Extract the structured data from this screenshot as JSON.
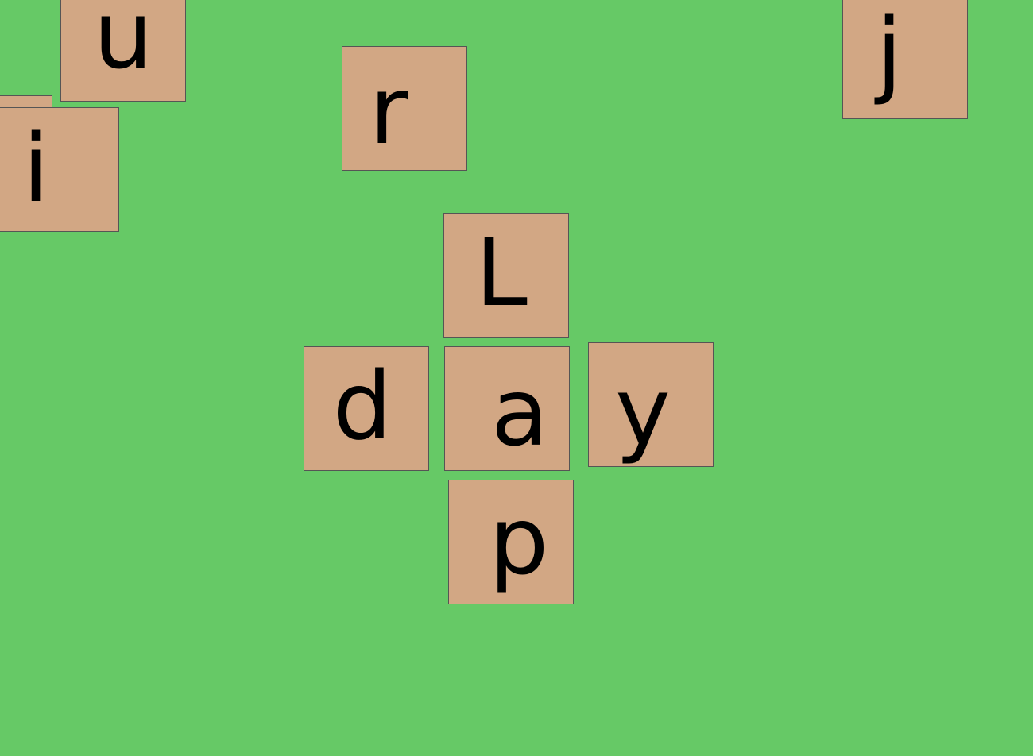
{
  "board": {
    "background_color": "#66c966",
    "tile_color": "#d2a784",
    "tiles": [
      {
        "letter": "u"
      },
      {
        "letter": "r"
      },
      {
        "letter": "j"
      },
      {
        "letter": ""
      },
      {
        "letter": "i"
      },
      {
        "letter": "L"
      },
      {
        "letter": "d"
      },
      {
        "letter": "a"
      },
      {
        "letter": "y"
      },
      {
        "letter": "p"
      }
    ]
  }
}
